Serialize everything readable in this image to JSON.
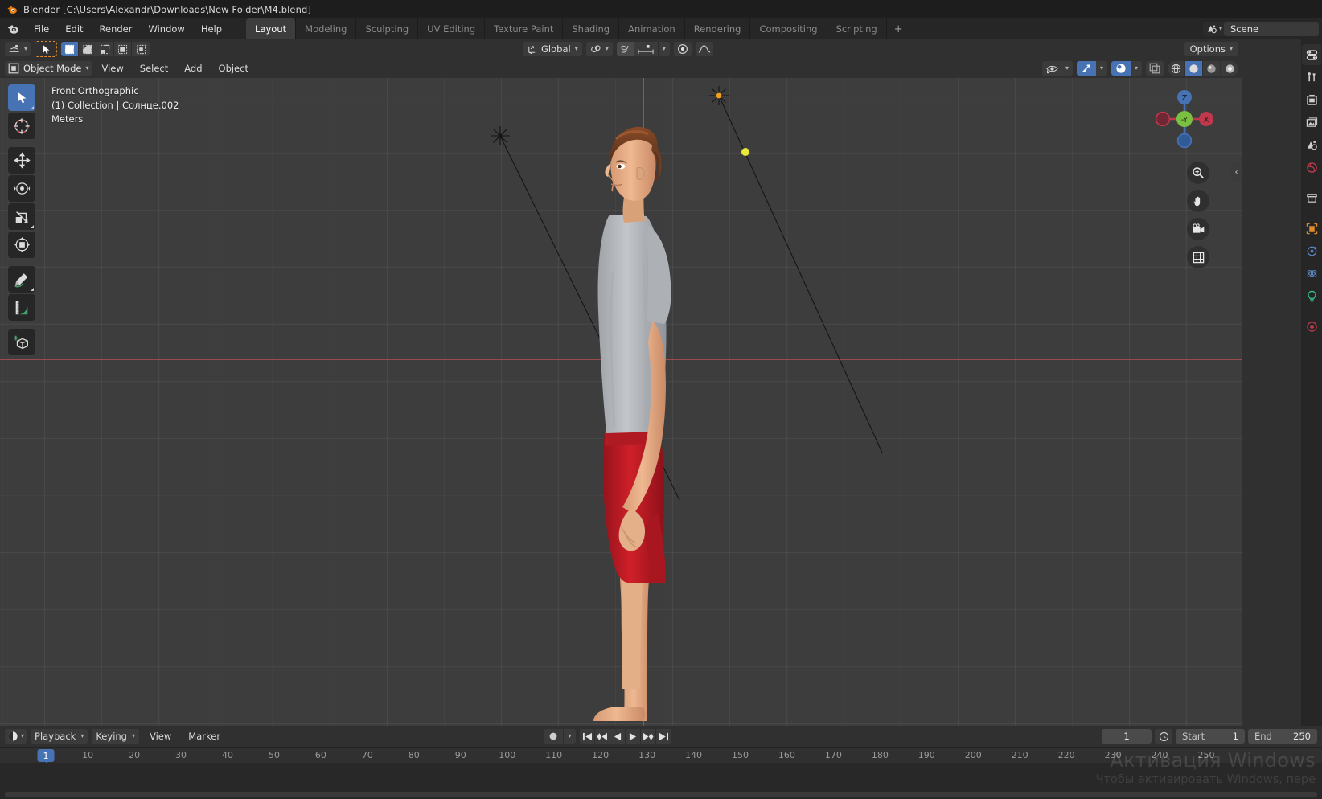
{
  "window": {
    "title": "Blender [C:\\Users\\Alexandr\\Downloads\\New Folder\\M4.blend]",
    "logo_icon": "blender-logo-icon"
  },
  "topbar": {
    "logo_icon": "blender-menu-logo-icon",
    "menus": [
      "File",
      "Edit",
      "Render",
      "Window",
      "Help"
    ],
    "workspaces": [
      {
        "label": "Layout",
        "active": true
      },
      {
        "label": "Modeling",
        "active": false
      },
      {
        "label": "Sculpting",
        "active": false
      },
      {
        "label": "UV Editing",
        "active": false
      },
      {
        "label": "Texture Paint",
        "active": false
      },
      {
        "label": "Shading",
        "active": false
      },
      {
        "label": "Animation",
        "active": false
      },
      {
        "label": "Rendering",
        "active": false
      },
      {
        "label": "Compositing",
        "active": false
      },
      {
        "label": "Scripting",
        "active": false
      }
    ],
    "add_workspace_label": "+",
    "scene_icon": "scene-icon",
    "scene_name": "Scene"
  },
  "tool_settings": {
    "active_tool_icon": "cursor-tool-icon",
    "select_mode_icon": "select-box-icon",
    "select_modes": [
      "set-new-icon",
      "extend-icon",
      "subtract-icon",
      "invert-icon",
      "intersect-icon"
    ],
    "transform_orientation_icon": "orientation-axes-icon",
    "transform_orientation": "Global",
    "snap_icon": "magnet-icon",
    "snap_target_icon": "snap-increment-icon",
    "proportional_icon": "proportional-editing-icon",
    "proportional_falloff_icon": "falloff-curve-icon",
    "options_label": "Options"
  },
  "viewport_header": {
    "mode_icon": "object-mode-icon",
    "mode": "Object Mode",
    "menus": [
      "View",
      "Select",
      "Add",
      "Object"
    ],
    "visibility_icon": "visibility-eye-icon",
    "gizmo_icon": "gizmo-icon",
    "overlay_icon": "overlays-icon",
    "xray_icon": "xray-toggle-icon",
    "shading_modes": [
      "wireframe-shading-icon",
      "solid-shading-icon",
      "material-preview-icon",
      "rendered-shading-icon"
    ],
    "shading_active_index": 1
  },
  "viewport": {
    "info_lines": [
      "Front Orthographic",
      "(1) Collection | Солнце.002",
      "Meters"
    ],
    "toolbar": [
      {
        "icon": "tweak-select-box-icon",
        "active": true
      },
      {
        "icon": "cursor-3d-icon",
        "active": false
      },
      {
        "icon": "move-tool-icon",
        "active": false
      },
      {
        "icon": "rotate-tool-icon",
        "active": false
      },
      {
        "icon": "scale-tool-icon",
        "active": false
      },
      {
        "icon": "transform-tool-icon",
        "active": false
      },
      {
        "icon": "annotate-tool-icon",
        "active": false
      },
      {
        "icon": "measure-tool-icon",
        "active": false
      },
      {
        "icon": "add-cube-tool-icon",
        "active": false
      }
    ],
    "gizmo": {
      "axes": [
        {
          "label": "Z",
          "color": "#4772b3",
          "filled": true
        },
        {
          "label": "-Y",
          "color": "#7bc043",
          "filled": true
        },
        {
          "label": "X",
          "color": "#c0384b",
          "filled": true
        },
        {
          "label": "",
          "color": "#4772b3",
          "filled": false
        },
        {
          "label": "",
          "color": "#c0384b",
          "filled": false
        }
      ]
    },
    "nav_buttons": [
      "zoom-icon",
      "pan-hand-icon",
      "camera-view-icon",
      "toggle-ortho-persp-icon"
    ],
    "sidebar_toggle_icon": "chevron-left-icon",
    "colors": {
      "background": "#3d3d3d",
      "axis_x": "#9c4a4f",
      "axis_z": "#3f6ea8",
      "light_selected": "#f0a020",
      "light_unselected": "#000000",
      "light_point": "#e8e83a",
      "shirt": "#b9bcc0",
      "shorts": "#c1222b",
      "skin": "#e8b48c",
      "hair": "#6b3a22"
    }
  },
  "properties_rail": {
    "tabs": [
      {
        "icon": "tool-properties-icon",
        "active": true
      },
      {
        "icon": "render-properties-icon",
        "active": false
      },
      {
        "icon": "output-properties-icon",
        "active": false
      },
      {
        "icon": "view-layer-properties-icon",
        "active": false
      },
      {
        "icon": "scene-properties-icon",
        "active": false
      },
      {
        "icon": "world-properties-icon",
        "active": false
      },
      {
        "icon": "collection-properties-icon",
        "active": false
      },
      {
        "icon": "object-properties-icon",
        "active": false
      },
      {
        "icon": "modifier-properties-icon",
        "active": false
      },
      {
        "icon": "physics-properties-icon",
        "active": false
      },
      {
        "icon": "object-data-light-icon",
        "active": false
      },
      {
        "icon": "material-properties-icon",
        "active": false
      }
    ]
  },
  "timeline": {
    "editor_type_icon": "timeline-editor-icon",
    "menus": [
      {
        "label": "Playback",
        "dropdown": true
      },
      {
        "label": "Keying",
        "dropdown": true
      },
      {
        "label": "View",
        "dropdown": false
      },
      {
        "label": "Marker",
        "dropdown": false
      }
    ],
    "record_icon": "auto-keying-record-icon",
    "transport": [
      "jump-to-start-icon",
      "jump-to-prev-keyframe-icon",
      "play-reverse-icon",
      "play-icon",
      "jump-to-next-keyframe-icon",
      "jump-to-end-icon"
    ],
    "current_frame": "1",
    "start_label": "Start",
    "start_value": "1",
    "end_label": "End",
    "end_value": "250",
    "autokey_icon": "auto-keyframe-icon",
    "ruler_ticks": [
      "1",
      "10",
      "20",
      "30",
      "40",
      "50",
      "60",
      "70",
      "80",
      "90",
      "100",
      "110",
      "120",
      "130",
      "140",
      "150",
      "160",
      "170",
      "180",
      "190",
      "200",
      "210",
      "220",
      "230",
      "240",
      "250"
    ],
    "playhead_frame": "1",
    "playhead_color": "#4772b3"
  },
  "watermark": {
    "line1": "Активация Windows",
    "line2": "Чтобы активировать Windows, пере"
  }
}
